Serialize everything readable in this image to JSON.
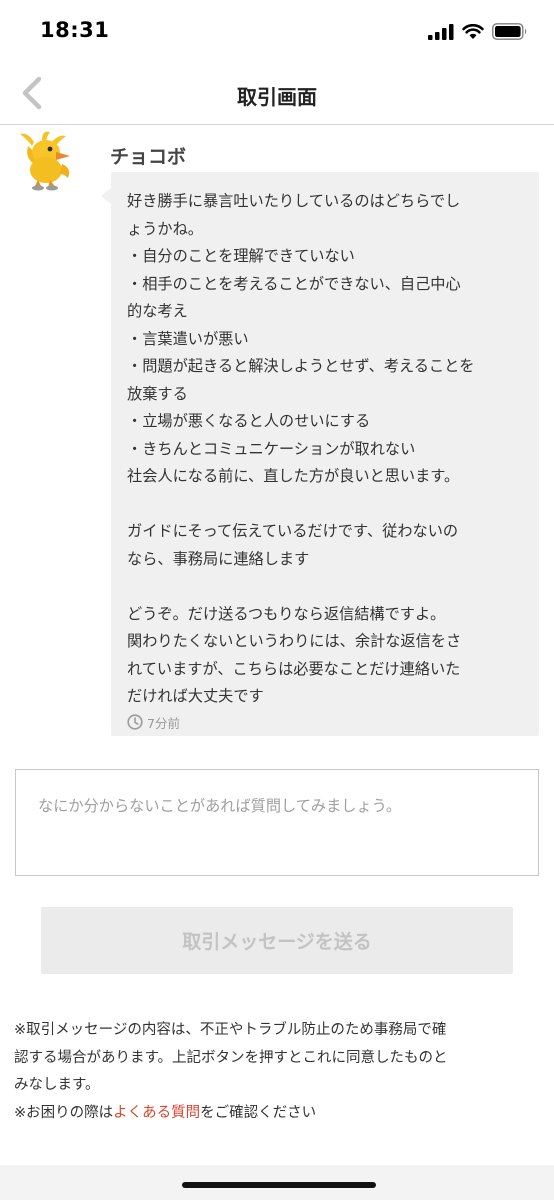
{
  "status_bar": {
    "time": "18:31"
  },
  "header": {
    "title": "取引画面"
  },
  "message": {
    "sender_name": "チョコボ",
    "lines": [
      "好き勝手に暴言吐いたりしているのはどちらでし",
      "ょうかね。",
      "・自分のことを理解できていない",
      "・相手のことを考えることができない、自己中心",
      "的な考え",
      "・言葉遣いが悪い",
      "・問題が起きると解決しようとせず、考えることを",
      "放棄する",
      "・立場が悪くなると人のせいにする",
      "・きちんとコミュニケーションが取れない",
      "社会人になる前に、直した方が良いと思います。",
      "",
      "ガイドにそって伝えているだけです、従わないの",
      "なら、事務局に連絡します",
      "",
      "どうぞ。だけ送るつもりなら返信結構ですよ。",
      "関わりたくないというわりには、余計な返信をさ",
      "れていますが、こちらは必要なことだけ連絡いた",
      "だければ大丈夫です"
    ],
    "time_ago": "7分前"
  },
  "input": {
    "placeholder": "なにか分からないことがあれば質問してみましょう。"
  },
  "send_button": {
    "label": "取引メッセージを送る"
  },
  "notice": {
    "line1": "※取引メッセージの内容は、不正やトラブル防止のため事務局で確",
    "line2": "認する場合があります。上記ボタンを押すとこれに同意したものと",
    "line3": "みなします。",
    "line4_prefix": "※お困りの際は",
    "line4_link": "よくある質問",
    "line4_suffix": "をご確認ください"
  },
  "colors": {
    "link": "#d9452f",
    "bubble": "#f0f0f0",
    "button_disabled": "#ebebeb"
  },
  "icons": {
    "back": "chevron-left-icon",
    "clock": "clock-icon",
    "signal": "signal-icon",
    "wifi": "wifi-icon",
    "battery": "battery-icon"
  }
}
